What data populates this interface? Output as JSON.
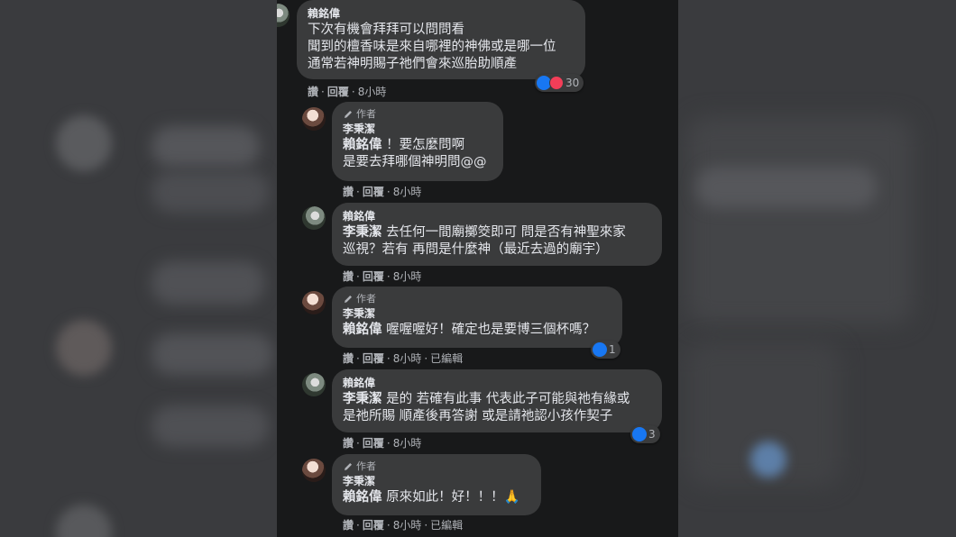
{
  "colors": {
    "background": "#18191a",
    "bubble": "#3a3b3c",
    "text": "#e4e6eb",
    "secondary_text": "#b0b3b8",
    "like": "#1877f2",
    "love": "#f33e58"
  },
  "comments": [
    {
      "kind": "user",
      "name": "賴銘偉",
      "lines": [
        "下次有機會拜拜可以問問看",
        "聞到的檀香味是來自哪裡的神佛或是哪一位",
        "通常若神明賜子祂們會來巡胎助順產"
      ],
      "actions": {
        "like": "讚",
        "reply": "回覆",
        "time": "8小時"
      },
      "reaction_count": "30"
    },
    {
      "kind": "author",
      "badge": "作者",
      "name": "李秉潔",
      "mention": "賴銘偉",
      "lines": [
        " ！要怎麼問啊",
        "是要去拜哪個神明問@@"
      ],
      "actions": {
        "like": "讚",
        "reply": "回覆",
        "time": "8小時"
      }
    },
    {
      "kind": "user",
      "name": "賴銘偉",
      "mention": "李秉潔",
      "lines": [
        " 去任何一間廟擲筊即可 問是否有神聖來家",
        "巡視？若有 再問是什麼神（最近去過的廟宇）"
      ],
      "actions": {
        "like": "讚",
        "reply": "回覆",
        "time": "8小時"
      }
    },
    {
      "kind": "author",
      "badge": "作者",
      "name": "李秉潔",
      "mention": "賴銘偉",
      "lines": [
        " 喔喔喔好！確定也是要博三個杯嗎？"
      ],
      "actions": {
        "like": "讚",
        "reply": "回覆",
        "time": "8小時",
        "edited": "已編輯"
      },
      "reaction_count": "1"
    },
    {
      "kind": "user",
      "name": "賴銘偉",
      "mention": "李秉潔",
      "lines": [
        " 是的 若確有此事 代表此子可能與祂有緣或",
        "是祂所賜 順產後再答謝 或是請祂認小孩作契子"
      ],
      "actions": {
        "like": "讚",
        "reply": "回覆",
        "time": "8小時"
      },
      "reaction_count": "3"
    },
    {
      "kind": "author",
      "badge": "作者",
      "name": "李秉潔",
      "mention": "賴銘偉",
      "lines": [
        " 原來如此！好！！！🙏"
      ],
      "actions": {
        "like": "讚",
        "reply": "回覆",
        "time": "8小時",
        "edited": "已編輯"
      }
    }
  ]
}
